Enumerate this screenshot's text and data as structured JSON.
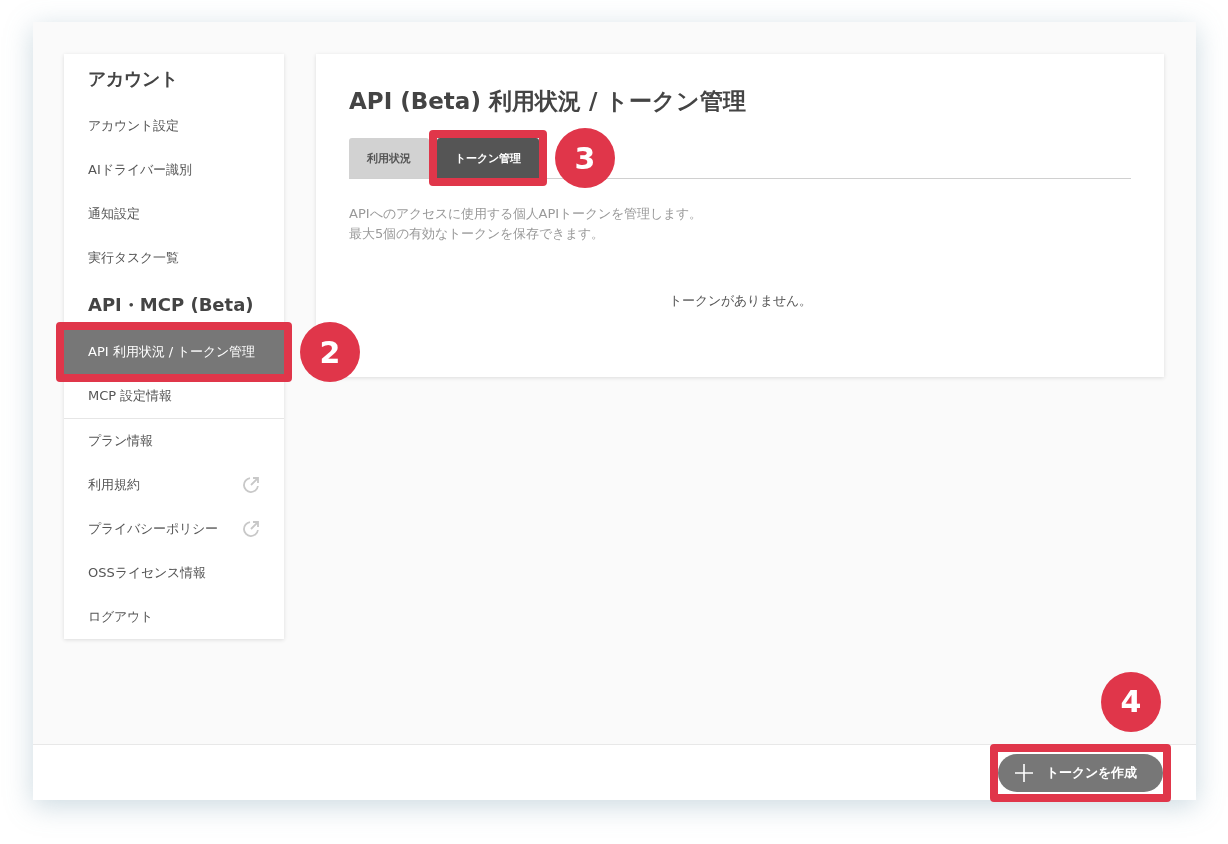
{
  "sidebar": {
    "sections": [
      {
        "heading": "アカウント",
        "items": [
          {
            "label": "アカウント設定",
            "selected": false
          },
          {
            "label": "AIドライバー識別",
            "selected": false
          },
          {
            "label": "通知設定",
            "selected": false
          },
          {
            "label": "実行タスク一覧",
            "selected": false
          }
        ]
      },
      {
        "heading": "API・MCP (Beta)",
        "items": [
          {
            "label": "API 利用状況 / トークン管理",
            "selected": true,
            "callout": "2"
          },
          {
            "label": "MCP 設定情報",
            "selected": false
          }
        ]
      },
      {
        "items": [
          {
            "label": "プラン情報",
            "selected": false,
            "external": false
          },
          {
            "label": "利用規約",
            "selected": false,
            "external": true
          },
          {
            "label": "プライバシーポリシー",
            "selected": false,
            "external": true
          },
          {
            "label": "OSSライセンス情報",
            "selected": false,
            "external": false
          },
          {
            "label": "ログアウト",
            "selected": false,
            "external": false
          }
        ]
      }
    ]
  },
  "main": {
    "title": "API (Beta) 利用状況 / トークン管理",
    "tabs": [
      {
        "label": "利用状況",
        "selected": false
      },
      {
        "label": "トークン管理",
        "selected": true,
        "callout": "3"
      }
    ],
    "description_lines": [
      "APIへのアクセスに使用する個人APIトークンを管理します。",
      "最大5個の有効なトークンを保存できます。"
    ],
    "empty_message": "トークンがありません。"
  },
  "footer": {
    "create_button": {
      "label": "トークンを作成",
      "callout": "4"
    }
  }
}
